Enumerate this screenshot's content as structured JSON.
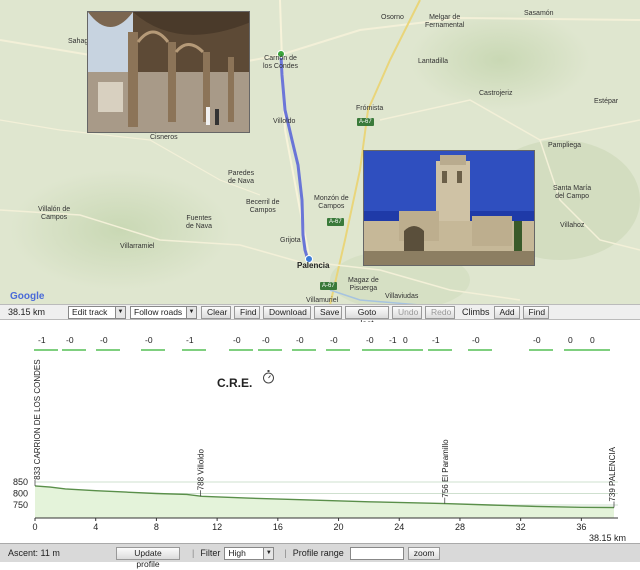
{
  "map": {
    "places": [
      {
        "name": "Osorno",
        "cls": ""
      },
      {
        "name": "Melgar de\nFernamental",
        "cls": ""
      },
      {
        "name": "Sasamón",
        "cls": ""
      },
      {
        "name": "Sahagún",
        "cls": ""
      },
      {
        "name": "Carrión de\nlos Condes",
        "cls": ""
      },
      {
        "name": "Lantadilla",
        "cls": ""
      },
      {
        "name": "Castrojeriz",
        "cls": ""
      },
      {
        "name": "Estépar",
        "cls": ""
      },
      {
        "name": "Frómista",
        "cls": ""
      },
      {
        "name": "Villoldo",
        "cls": ""
      },
      {
        "name": "Cisneros",
        "cls": ""
      },
      {
        "name": "Pampliega",
        "cls": ""
      },
      {
        "name": "Paredes\nde Nava",
        "cls": ""
      },
      {
        "name": "Santa María\ndel Campo",
        "cls": ""
      },
      {
        "name": "Villalón de\nCampos",
        "cls": ""
      },
      {
        "name": "Becerril de\nCampos",
        "cls": ""
      },
      {
        "name": "Monzón de\nCampos",
        "cls": ""
      },
      {
        "name": "Villahoz",
        "cls": ""
      },
      {
        "name": "Fuentes\nde Nava",
        "cls": ""
      },
      {
        "name": "Grijota",
        "cls": ""
      },
      {
        "name": "Villarramiel",
        "cls": ""
      },
      {
        "name": "Palencia",
        "cls": "big"
      },
      {
        "name": "Magaz de\nPisuerga",
        "cls": ""
      },
      {
        "name": "Villamuriel",
        "cls": ""
      },
      {
        "name": "Villaviudas",
        "cls": ""
      },
      {
        "name": "Osorno",
        "cls": ""
      }
    ],
    "roads": [
      "A-67",
      "A-67",
      "A-67"
    ],
    "google_logo": "Google",
    "colors": {
      "route": "#5560d8",
      "land": "#dfe6cf",
      "marker_start": "#3aa63a",
      "marker_end": "#3a7ad8"
    }
  },
  "toolbar": {
    "distance": "38.15 km",
    "edit_select": "Edit track",
    "roads_select": "Follow roads",
    "clear": "Clear",
    "find": "Find",
    "download": "Download",
    "save": "Save",
    "goto_last": "Goto last",
    "undo": "Undo",
    "redo": "Redo",
    "climbs": "Climbs",
    "add": "Add",
    "find2": "Find"
  },
  "elevation": {
    "gradients": [
      "-1",
      "-0",
      "-0",
      "-0",
      "-1",
      "-0",
      "-0",
      "-0",
      "-0",
      "-0",
      "-1",
      "0",
      "-1",
      "-0",
      "-0",
      "0",
      "0"
    ],
    "title": "C.R.E.",
    "y_ticks": [
      "850",
      "800",
      "750"
    ],
    "x_ticks": [
      "0",
      "4",
      "8",
      "12",
      "16",
      "20",
      "24",
      "28",
      "32",
      "36"
    ],
    "end_distance": "38.15 km",
    "waypoints": [
      "833 CARRION DE LOS CONDES",
      "788 Villoldo",
      "756 El Paramillo",
      "739 PALENCIA"
    ]
  },
  "chart_data": {
    "type": "area",
    "title": "C.R.E.",
    "xlabel": "km",
    "ylabel": "",
    "xlim": [
      0,
      38.15
    ],
    "ylim": [
      700,
      870
    ],
    "x": [
      0,
      1,
      2,
      4,
      6,
      8,
      10,
      11,
      14,
      18,
      22,
      26,
      27,
      30,
      33,
      36,
      38.15
    ],
    "y": [
      833,
      828,
      820,
      812,
      806,
      800,
      796,
      788,
      780,
      772,
      764,
      758,
      756,
      750,
      744,
      740,
      739
    ],
    "annotations": [
      {
        "x": 0,
        "y": 833,
        "text": "833 CARRION DE LOS CONDES"
      },
      {
        "x": 10.9,
        "y": 788,
        "text": "788 Villoldo"
      },
      {
        "x": 27,
        "y": 756,
        "text": "756 El Paramillo"
      },
      {
        "x": 38.15,
        "y": 739,
        "text": "739 PALENCIA"
      }
    ]
  },
  "bottombar": {
    "ascent": "Ascent: 11 m",
    "update_profile": "Update profile",
    "filter_label": "Filter",
    "filter_value": "High",
    "profile_range_label": "Profile range",
    "profile_range_value": "",
    "zoom": "zoom"
  }
}
